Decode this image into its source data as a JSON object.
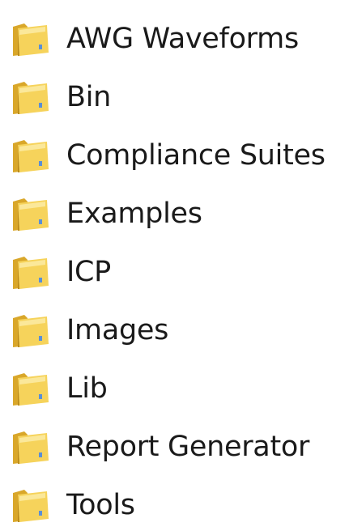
{
  "folders": {
    "items": [
      {
        "label": "AWG Waveforms",
        "icon": "folder-icon"
      },
      {
        "label": "Bin",
        "icon": "folder-icon"
      },
      {
        "label": "Compliance Suites",
        "icon": "folder-icon"
      },
      {
        "label": "Examples",
        "icon": "folder-icon"
      },
      {
        "label": "ICP",
        "icon": "folder-icon"
      },
      {
        "label": "Images",
        "icon": "folder-icon"
      },
      {
        "label": "Lib",
        "icon": "folder-icon"
      },
      {
        "label": "Report Generator",
        "icon": "folder-icon"
      },
      {
        "label": "Tools",
        "icon": "folder-icon"
      }
    ]
  },
  "colors": {
    "folder_back": "#d9a72a",
    "folder_front": "#f6d35b",
    "folder_highlight": "#fbe89a",
    "folder_shadow": "#b98a1c",
    "text": "#1a1a1a"
  }
}
